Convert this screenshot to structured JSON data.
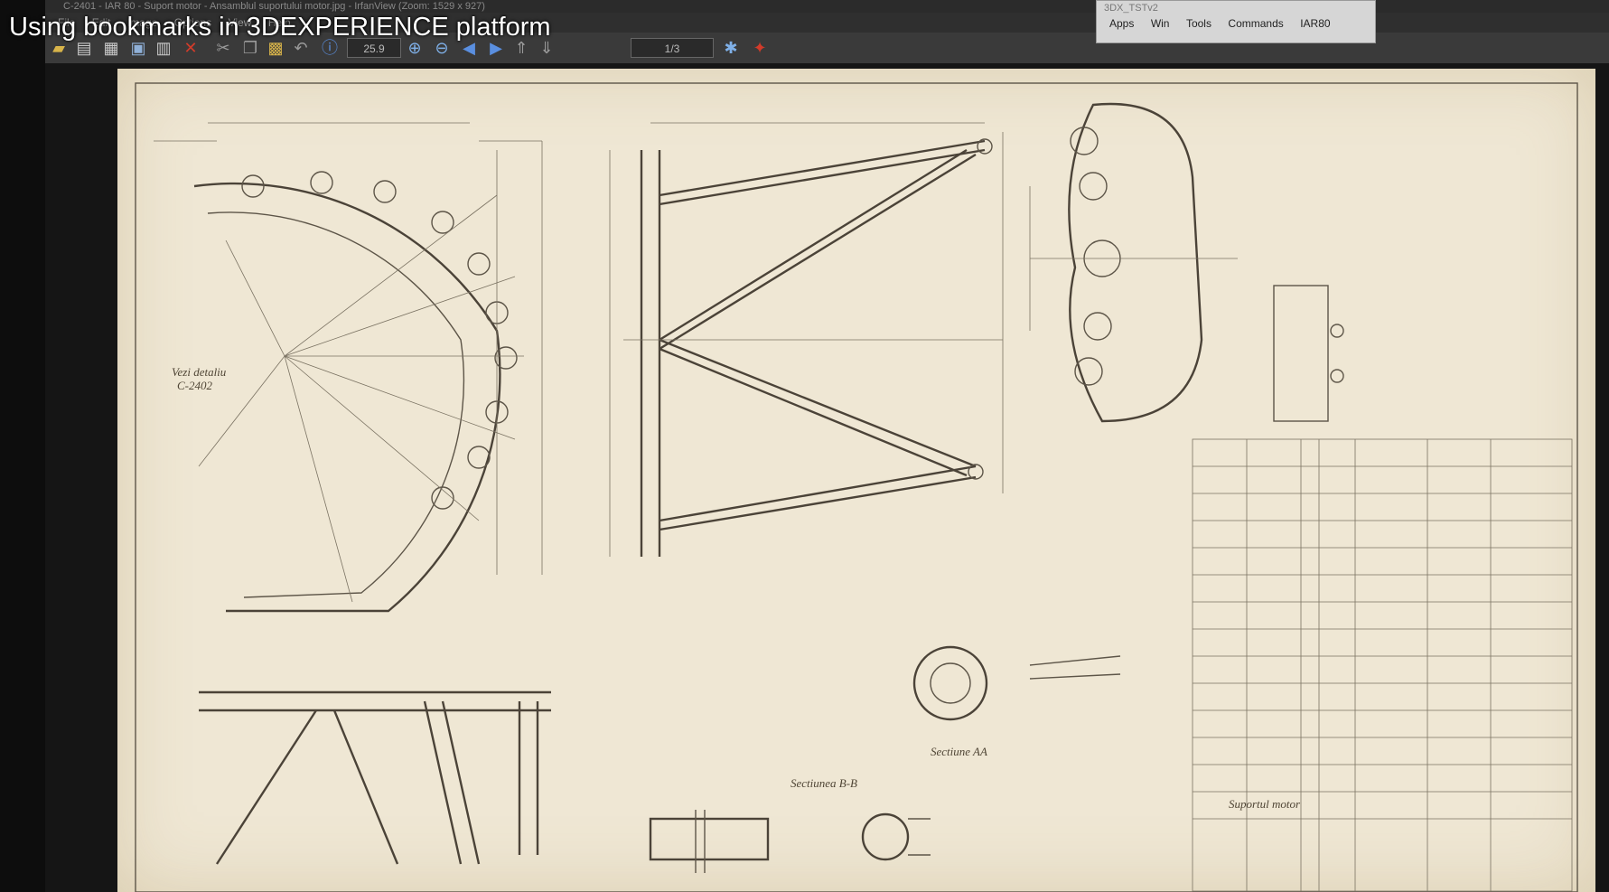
{
  "video": {
    "title": "Using bookmarks in 3DEXPERIENCE platform"
  },
  "window": {
    "title": "C-2401 - IAR 80 - Suport motor - Ansamblul suportului motor.jpg - IrfanView (Zoom: 1529 x 927)",
    "menu": [
      "File",
      "Edit",
      "Image",
      "Options",
      "View",
      "Help"
    ]
  },
  "toolbar": {
    "zoom_value": "25.9",
    "page_indicator": "1/3"
  },
  "dx_panel": {
    "title": "3DX_TSTv2",
    "menu": [
      "Apps",
      "Win",
      "Tools",
      "Commands",
      "IAR80"
    ]
  },
  "drawing": {
    "labels": {
      "sectiune_bb": "Sectiunea B-B",
      "sectiune_aa": "Sectiune AA",
      "vezi_detaliu": "Vezi detaliu",
      "detaliu_ref": "C-2402",
      "bottom_title": "Suportul motor"
    }
  },
  "colors": {
    "paper": "#efe7d4",
    "ink": "#5d5548",
    "toolbar_bg": "#3a3a3a",
    "icon_accent": "#d8b44a"
  }
}
